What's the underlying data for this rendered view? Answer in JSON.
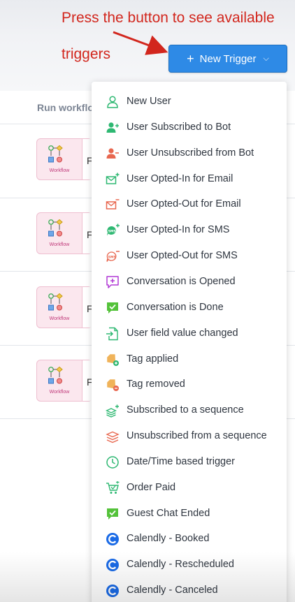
{
  "annotation": {
    "line1": "Press the button to see available",
    "line2": "triggers",
    "color": "#d2261d"
  },
  "new_trigger_button": {
    "plus": "+",
    "label": "New Trigger",
    "chevron": "⌵",
    "color": "#2e8ae6"
  },
  "table": {
    "column_header": "Run workflo",
    "rows": [
      {
        "card_label": "Workflow",
        "name": "F"
      },
      {
        "card_label": "Workflow",
        "name": "F"
      },
      {
        "card_label": "Workflow",
        "name": "F"
      },
      {
        "card_label": "Workflow",
        "name": "F"
      }
    ]
  },
  "trigger_menu": {
    "items": [
      {
        "label": "New User",
        "icon": "user-outline-icon",
        "color": "#2eb872"
      },
      {
        "label": "User Subscribed to Bot",
        "icon": "user-plus-icon",
        "color": "#2eb872"
      },
      {
        "label": "User Unsubscribed from Bot",
        "icon": "user-minus-icon",
        "color": "#e8674f"
      },
      {
        "label": "User Opted-In for Email",
        "icon": "email-plus-icon",
        "color": "#2eb872"
      },
      {
        "label": "User Opted-Out for Email",
        "icon": "email-minus-icon",
        "color": "#e8674f"
      },
      {
        "label": "User Opted-In for SMS",
        "icon": "sms-plus-icon",
        "color": "#2eb872"
      },
      {
        "label": "User Opted-Out for SMS",
        "icon": "sms-minus-icon",
        "color": "#e8674f"
      },
      {
        "label": "Conversation is Opened",
        "icon": "chat-plus-icon",
        "color": "#b23ad6"
      },
      {
        "label": "Conversation is Done",
        "icon": "chat-check-icon",
        "color": "#54c23a"
      },
      {
        "label": "User field value changed",
        "icon": "field-change-icon",
        "color": "#2eb872"
      },
      {
        "label": "Tag applied",
        "icon": "tag-plus-icon",
        "color": "#f0b35a"
      },
      {
        "label": "Tag removed",
        "icon": "tag-minus-icon",
        "color": "#f0b35a"
      },
      {
        "label": "Subscribed to a sequence",
        "icon": "sequence-plus-icon",
        "color": "#2eb872"
      },
      {
        "label": "Unsubscribed from a sequence",
        "icon": "sequence-minus-icon",
        "color": "#e8674f"
      },
      {
        "label": "Date/Time based trigger",
        "icon": "clock-icon",
        "color": "#2eb872"
      },
      {
        "label": "Order Paid",
        "icon": "cart-check-icon",
        "color": "#2eb872"
      },
      {
        "label": "Guest Chat Ended",
        "icon": "chat-check-icon",
        "color": "#54c23a"
      },
      {
        "label": "Calendly - Booked",
        "icon": "calendly-icon",
        "color": "#1a6ae6"
      },
      {
        "label": "Calendly - Rescheduled",
        "icon": "calendly-icon",
        "color": "#1a6ae6"
      },
      {
        "label": "Calendly - Canceled",
        "icon": "calendly-icon",
        "color": "#1a6ae6"
      }
    ]
  }
}
